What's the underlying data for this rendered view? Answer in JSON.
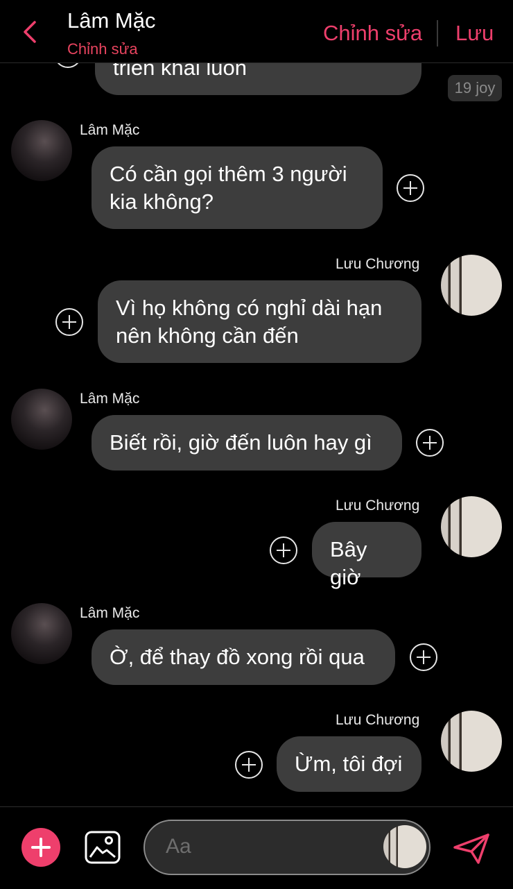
{
  "header": {
    "title": "Lâm Mặc",
    "subtitle": "Chỉnh sửa",
    "edit_label": "Chỉnh sửa",
    "save_label": "Lưu"
  },
  "messages": [
    {
      "sender": "",
      "side": "right",
      "text": "triển khai luôn"
    },
    {
      "sender": "Lâm Mặc",
      "side": "left",
      "text": "Có cần gọi thêm 3 người kia không?"
    },
    {
      "sender": "Lưu Chương",
      "side": "right",
      "text": "Vì họ không có nghỉ dài hạn nên không cần đến"
    },
    {
      "sender": "Lâm Mặc",
      "side": "left",
      "text": "Biết rồi, giờ đến luôn hay gì"
    },
    {
      "sender": "Lưu Chương",
      "side": "right",
      "text": "Bây giờ"
    },
    {
      "sender": "Lâm Mặc",
      "side": "left",
      "text": "Ờ, để thay đồ xong rồi qua"
    },
    {
      "sender": "Lưu Chương",
      "side": "right",
      "text": "Ừm, tôi đợi"
    }
  ],
  "time_badge": "19 joy",
  "composer": {
    "placeholder": "Aa"
  },
  "colors": {
    "accent": "#ee3f6c",
    "bubble": "#3d3d3d",
    "background": "#000000"
  },
  "icons": {
    "back": "chevron-left-icon",
    "add": "plus-icon",
    "image": "image-icon",
    "send": "send-icon",
    "reaction": "plus-circle-icon"
  }
}
